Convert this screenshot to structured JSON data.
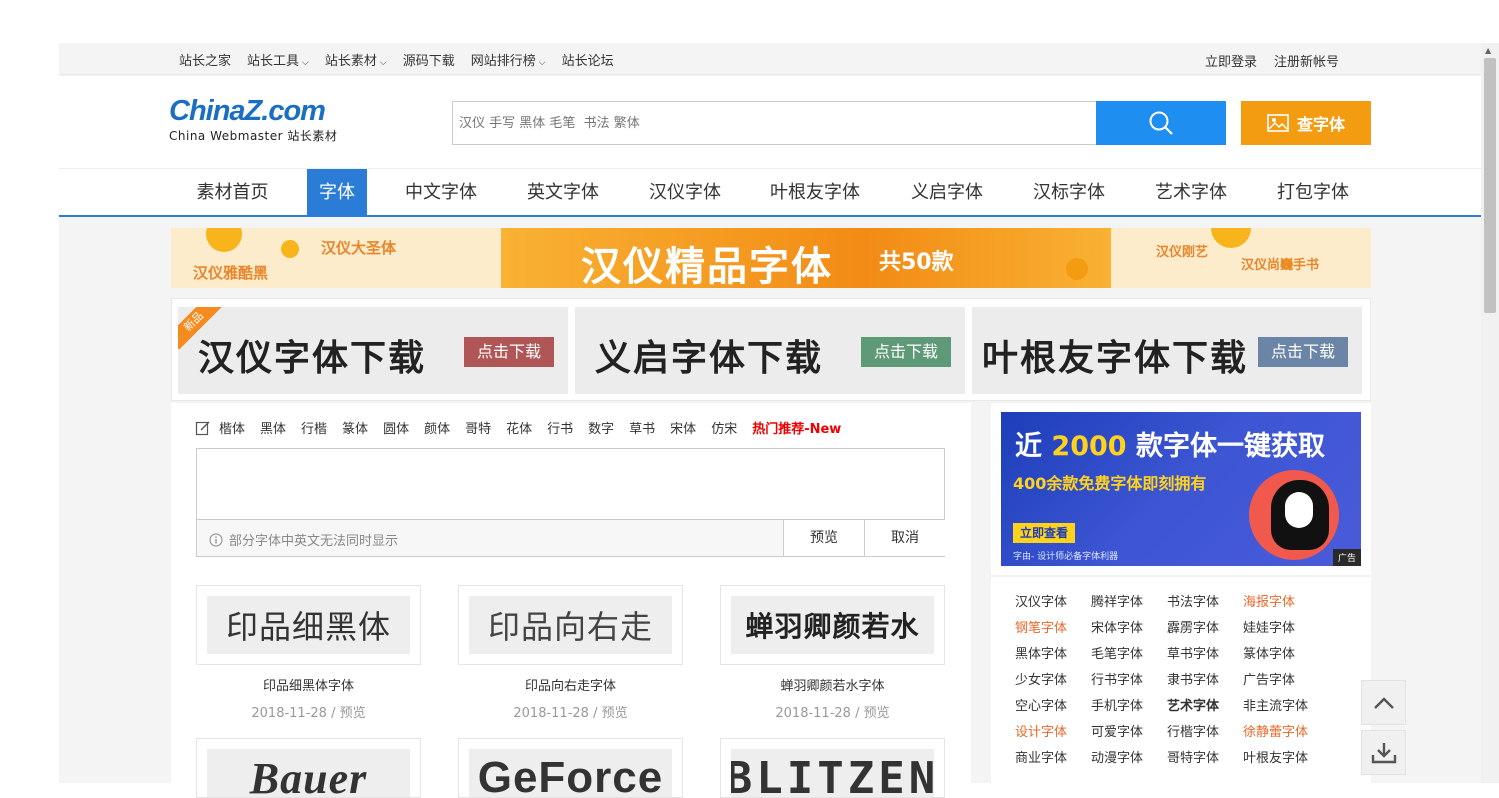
{
  "topbar": {
    "links": [
      "站长之家",
      "站长工具",
      "站长素材",
      "源码下载",
      "网站排行榜",
      "站长论坛"
    ],
    "login": "立即登录",
    "register": "注册新帐号"
  },
  "logo": {
    "main": "ChinaZ",
    "suffix": ".com",
    "sub": "China Webmaster 站长素材"
  },
  "search": {
    "placeholder": "汉仪 手写 黑体 毛笔  书法 繁体",
    "query_label": "查字体"
  },
  "nav": [
    "素材首页",
    "字体",
    "中文字体",
    "英文字体",
    "汉仪字体",
    "叶根友字体",
    "义启字体",
    "汉标字体",
    "艺术字体",
    "打包字体"
  ],
  "nav_active": "字体",
  "banner_top": {
    "title": "汉仪精品字体",
    "count": "共50款",
    "left_a": "汉仪大圣体",
    "left_b": "汉仪雅酷黑",
    "right_a": "汉仪刚艺",
    "right_b": "汉仪尚巍手书"
  },
  "banner_row": [
    {
      "title": "汉仪字体下载",
      "button": "点击下载",
      "ribbon": "新品",
      "btn_color": "#b05656"
    },
    {
      "title": "义启字体下载",
      "button": "点击下载",
      "ribbon": "",
      "btn_color": "#5e9a78"
    },
    {
      "title": "叶根友字体下载",
      "button": "点击下载",
      "ribbon": "",
      "btn_color": "#6a85a6"
    }
  ],
  "categories": [
    "楷体",
    "黑体",
    "行楷",
    "篆体",
    "圆体",
    "颜体",
    "哥特",
    "花体",
    "行书",
    "数字",
    "草书",
    "宋体",
    "仿宋"
  ],
  "hot_label": "热门推荐-New",
  "preview": {
    "tip": "部分字体中英文无法同时显示",
    "preview_btn": "预览",
    "cancel_btn": "取消"
  },
  "fonts": [
    {
      "sample": "印品细黑体",
      "name": "印品细黑体字体",
      "date": "2018-11-28",
      "action": "预览"
    },
    {
      "sample": "印品向右走",
      "name": "印品向右走字体",
      "date": "2018-11-28",
      "action": "预览"
    },
    {
      "sample": "蝉羽卿颜若水",
      "name": "蝉羽卿颜若水字体",
      "date": "2018-11-28",
      "action": "预览"
    }
  ],
  "fonts_row2": [
    {
      "sample": "Bauer"
    },
    {
      "sample": "GeForce"
    },
    {
      "sample": "BLITZEN"
    }
  ],
  "ad": {
    "headline_pre": "近",
    "headline_num": "2000",
    "headline_post": "款字体一键获取",
    "sub": "400余款免费字体即刻拥有",
    "cta": "立即查看",
    "foot": "字由- 设计师必备字体利器",
    "tag": "广告"
  },
  "tags": [
    {
      "t": "汉仪字体",
      "s": ""
    },
    {
      "t": "腾祥字体",
      "s": ""
    },
    {
      "t": "书法字体",
      "s": ""
    },
    {
      "t": "海报字体",
      "s": "o"
    },
    {
      "t": "钢笔字体",
      "s": "o"
    },
    {
      "t": "宋体字体",
      "s": ""
    },
    {
      "t": "霹雳字体",
      "s": ""
    },
    {
      "t": "娃娃字体",
      "s": ""
    },
    {
      "t": "黑体字体",
      "s": ""
    },
    {
      "t": "毛笔字体",
      "s": ""
    },
    {
      "t": "草书字体",
      "s": ""
    },
    {
      "t": "篆体字体",
      "s": ""
    },
    {
      "t": "少女字体",
      "s": ""
    },
    {
      "t": "行书字体",
      "s": ""
    },
    {
      "t": "隶书字体",
      "s": ""
    },
    {
      "t": "广告字体",
      "s": ""
    },
    {
      "t": "空心字体",
      "s": ""
    },
    {
      "t": "手机字体",
      "s": ""
    },
    {
      "t": "艺术字体",
      "s": "b"
    },
    {
      "t": "非主流字体",
      "s": ""
    },
    {
      "t": "设计字体",
      "s": "o"
    },
    {
      "t": "可爱字体",
      "s": ""
    },
    {
      "t": "行楷字体",
      "s": ""
    },
    {
      "t": "徐静蕾字体",
      "s": "o"
    },
    {
      "t": "商业字体",
      "s": ""
    },
    {
      "t": "动漫字体",
      "s": ""
    },
    {
      "t": "哥特字体",
      "s": ""
    },
    {
      "t": "叶根友字体",
      "s": ""
    }
  ],
  "colors": {
    "brand_blue": "#2a7cd6",
    "search_blue": "#1e8ef0",
    "query_orange": "#f39c12",
    "hot_red": "#ee0000",
    "tag_orange": "#e8692b"
  }
}
